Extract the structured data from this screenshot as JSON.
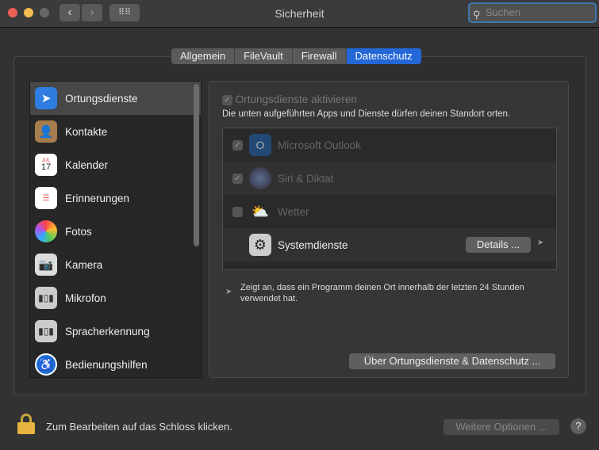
{
  "window": {
    "title": "Sicherheit",
    "search_placeholder": "Suchen"
  },
  "tabs": [
    {
      "label": "Allgemein"
    },
    {
      "label": "FileVault"
    },
    {
      "label": "Firewall"
    },
    {
      "label": "Datenschutz",
      "active": true
    }
  ],
  "sidebar": {
    "items": [
      {
        "label": "Ortungsdienste",
        "icon": "location-arrow-icon",
        "selected": true
      },
      {
        "label": "Kontakte",
        "icon": "contacts-icon"
      },
      {
        "label": "Kalender",
        "icon": "calendar-icon",
        "icon_text": "17",
        "icon_month": "JUL"
      },
      {
        "label": "Erinnerungen",
        "icon": "reminders-icon"
      },
      {
        "label": "Fotos",
        "icon": "photos-icon"
      },
      {
        "label": "Kamera",
        "icon": "camera-icon"
      },
      {
        "label": "Mikrofon",
        "icon": "microphone-icon"
      },
      {
        "label": "Spracherkennung",
        "icon": "speech-recognition-icon"
      },
      {
        "label": "Bedienungshilfen",
        "icon": "accessibility-icon"
      }
    ]
  },
  "location": {
    "enable_label": "Ortungsdienste aktivieren",
    "description": "Die unten aufgeführten Apps und Dienste dürfen deinen Standort orten.",
    "apps": [
      {
        "name": "Microsoft Outlook",
        "checked": true,
        "icon": "outlook-icon"
      },
      {
        "name": "Siri & Diktat",
        "checked": true,
        "icon": "siri-icon"
      },
      {
        "name": "Wetter",
        "checked": false,
        "icon": "weather-icon"
      },
      {
        "name": "Systemdienste",
        "icon": "system-preferences-icon",
        "details_label": "Details ..."
      }
    ],
    "legend": "Zeigt an, dass ein Programm deinen Ort innerhalb der letzten 24 Stunden verwendet hat.",
    "about_button": "Über Ortungsdienste & Datenschutz ..."
  },
  "footer": {
    "lock_text": "Zum Bearbeiten auf das Schloss klicken.",
    "more_options": "Weitere Optionen ...",
    "help": "?"
  },
  "colors": {
    "accent": "#2468d8"
  }
}
